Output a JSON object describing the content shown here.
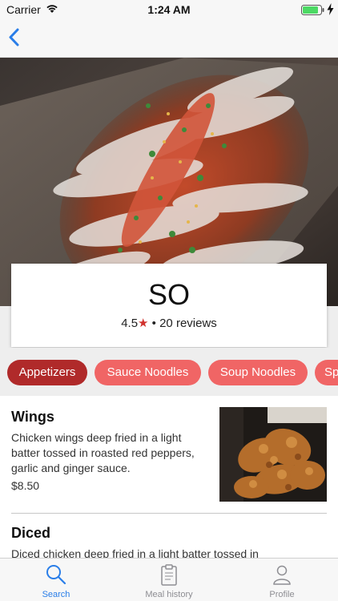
{
  "status_bar": {
    "carrier": "Carrier",
    "time": "1:24 AM"
  },
  "nav": {
    "back_icon": "chevron-left-icon"
  },
  "restaurant": {
    "name": "SO",
    "rating": "4.5",
    "star": "★",
    "reviews": "• 20 reviews"
  },
  "categories": [
    {
      "label": "Appetizers",
      "active": true
    },
    {
      "label": "Sauce Noodles",
      "active": false
    },
    {
      "label": "Soup Noodles",
      "active": false
    },
    {
      "label": "Sp",
      "active": false
    }
  ],
  "menu_items": [
    {
      "name": "Wings",
      "description": "Chicken wings deep fried in a light batter tossed in roasted red peppers, garlic and ginger sauce.",
      "price": "$8.50"
    },
    {
      "name": "Diced",
      "description": "Diced chicken deep fried in a light batter tossed in",
      "price": ""
    }
  ],
  "tab_bar": [
    {
      "label": "Search",
      "icon": "search-icon",
      "active": true
    },
    {
      "label": "Meal history",
      "icon": "clipboard-icon",
      "active": false
    },
    {
      "label": "Profile",
      "icon": "person-icon",
      "active": false
    }
  ],
  "colors": {
    "chip": "#f06565",
    "chip_active": "#b02a2a",
    "accent_blue": "#2a7ee8",
    "star": "#d0312d"
  }
}
